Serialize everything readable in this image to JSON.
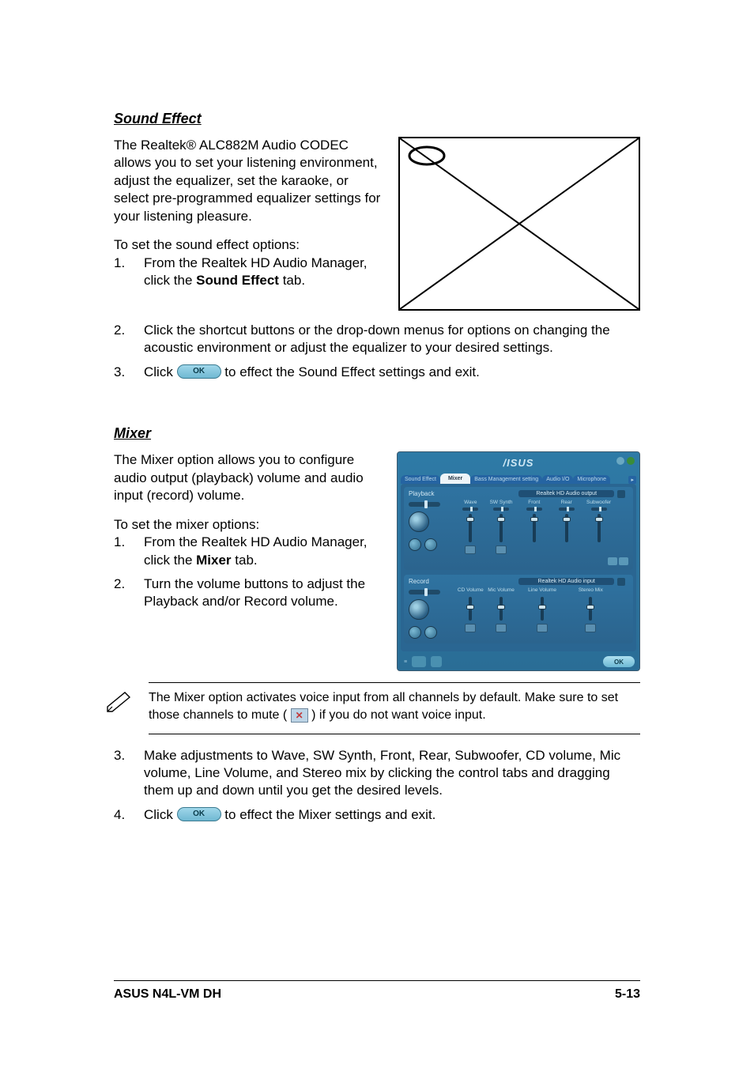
{
  "section1": {
    "title": "Sound Effect",
    "intro": "The Realtek® ALC882M Audio CODEC allows you to set your listening environment, adjust the equalizer, set the karaoke, or select pre-programmed equalizer settings for your listening pleasure.",
    "lead": "To set the sound effect options:",
    "steps": [
      {
        "num": "1.",
        "pre": "From the Realtek HD Audio Manager, click the ",
        "bold": "Sound Effect",
        "post": " tab."
      },
      {
        "num": "2.",
        "pre": "Click the shortcut buttons or the drop-down menus for options on changing the acoustic environment or adjust the equalizer to your desired settings.",
        "bold": "",
        "post": ""
      },
      {
        "num": "3.",
        "pre": "Click ",
        "okbtn": true,
        "post": " to effect the Sound Effect settings and exit."
      }
    ]
  },
  "section2": {
    "title": "Mixer",
    "intro": "The Mixer option allows you to configure audio output (playback) volume and audio input (record) volume.",
    "lead": "To set the mixer options:",
    "steps_a": [
      {
        "num": "1.",
        "pre": "From the Realtek HD Audio Manager, click the ",
        "bold": "Mixer",
        "post": " tab."
      },
      {
        "num": "2.",
        "pre": "Turn the volume buttons to adjust the Playback and/or Record volume.",
        "bold": "",
        "post": ""
      }
    ],
    "note": {
      "line1": "The Mixer option activates voice input from all channels by default. Make sure to set those channels to mute ( ",
      "line2": " ) if  you do not want voice input."
    },
    "steps_b": [
      {
        "num": "3.",
        "pre": "Make adjustments to Wave, SW Synth, Front, Rear, Subwoofer,  CD volume, Mic volume, Line Volume, and Stereo mix by clicking the control tabs and dragging them up and down until you get the desired levels.",
        "bold": "",
        "post": ""
      },
      {
        "num": "4.",
        "pre": "Click ",
        "okbtn": true,
        "post": " to effect the Mixer settings and exit."
      }
    ]
  },
  "mixer_shot": {
    "logo": "/‎ISUS",
    "tabs": [
      "Sound Effect",
      "Mixer",
      "Bass Management setting",
      "Audio I/O",
      "Microphone"
    ],
    "selected_tab": "Mixer",
    "playback": {
      "label": "Playback",
      "group1": {
        "title": "",
        "cols": [
          "Wave",
          "SW Synth"
        ]
      },
      "group2": {
        "title": "Realtek HD Audio output",
        "cols": [
          "Front",
          "Rear",
          "Subwoofer"
        ]
      }
    },
    "record": {
      "label": "Record",
      "group1": {
        "title": "",
        "cols": [
          "CD Volume",
          "Mic Volume"
        ]
      },
      "group2": {
        "title": "Realtek HD Audio input",
        "cols": [
          "Line Volume",
          "Stereo Mix"
        ]
      }
    },
    "ok": "OK"
  },
  "footer": {
    "left": "ASUS N4L-VM DH",
    "right": "5-13"
  }
}
